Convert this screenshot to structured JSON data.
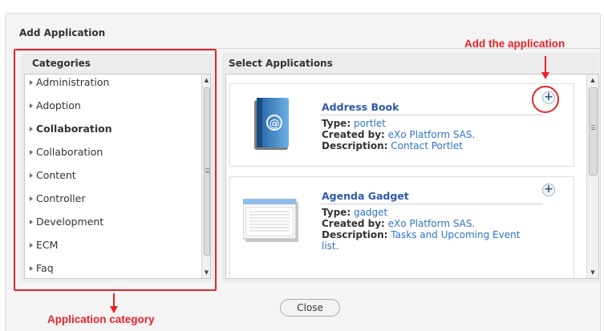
{
  "dialog": {
    "title": "Add Application",
    "close_label": "Close"
  },
  "categories": {
    "header": "Categories",
    "items": [
      {
        "label": "Administration",
        "bold": false
      },
      {
        "label": "Adoption",
        "bold": false
      },
      {
        "label": "Collaboration",
        "bold": true
      },
      {
        "label": "Collaboration",
        "bold": false
      },
      {
        "label": "Content",
        "bold": false
      },
      {
        "label": "Controller",
        "bold": false
      },
      {
        "label": "Development",
        "bold": false
      },
      {
        "label": "ECM",
        "bold": false
      },
      {
        "label": "Faq",
        "bold": false
      }
    ]
  },
  "applications": {
    "header": "Select Applications",
    "items": [
      {
        "name": "Address Book",
        "type_label": "Type:",
        "type": "portlet",
        "created_label": "Created by:",
        "created_by": "eXo Platform SAS.",
        "desc_label": "Description:",
        "description": "Contact Portlet",
        "description_cont": "",
        "icon": "address-book-icon"
      },
      {
        "name": "Agenda Gadget",
        "type_label": "Type:",
        "type": "gadget",
        "created_label": "Created by:",
        "created_by": "eXo Platform SAS.",
        "desc_label": "Description:",
        "description": "Tasks and Upcoming Event",
        "description_cont": "list.",
        "icon": "gadget-window-icon"
      }
    ]
  },
  "annotations": {
    "add_app": "Add the application",
    "app_category": "Application category"
  },
  "colors": {
    "annotation": "#e8232a",
    "link": "#2f72c8",
    "app_name": "#2f5aa5"
  }
}
